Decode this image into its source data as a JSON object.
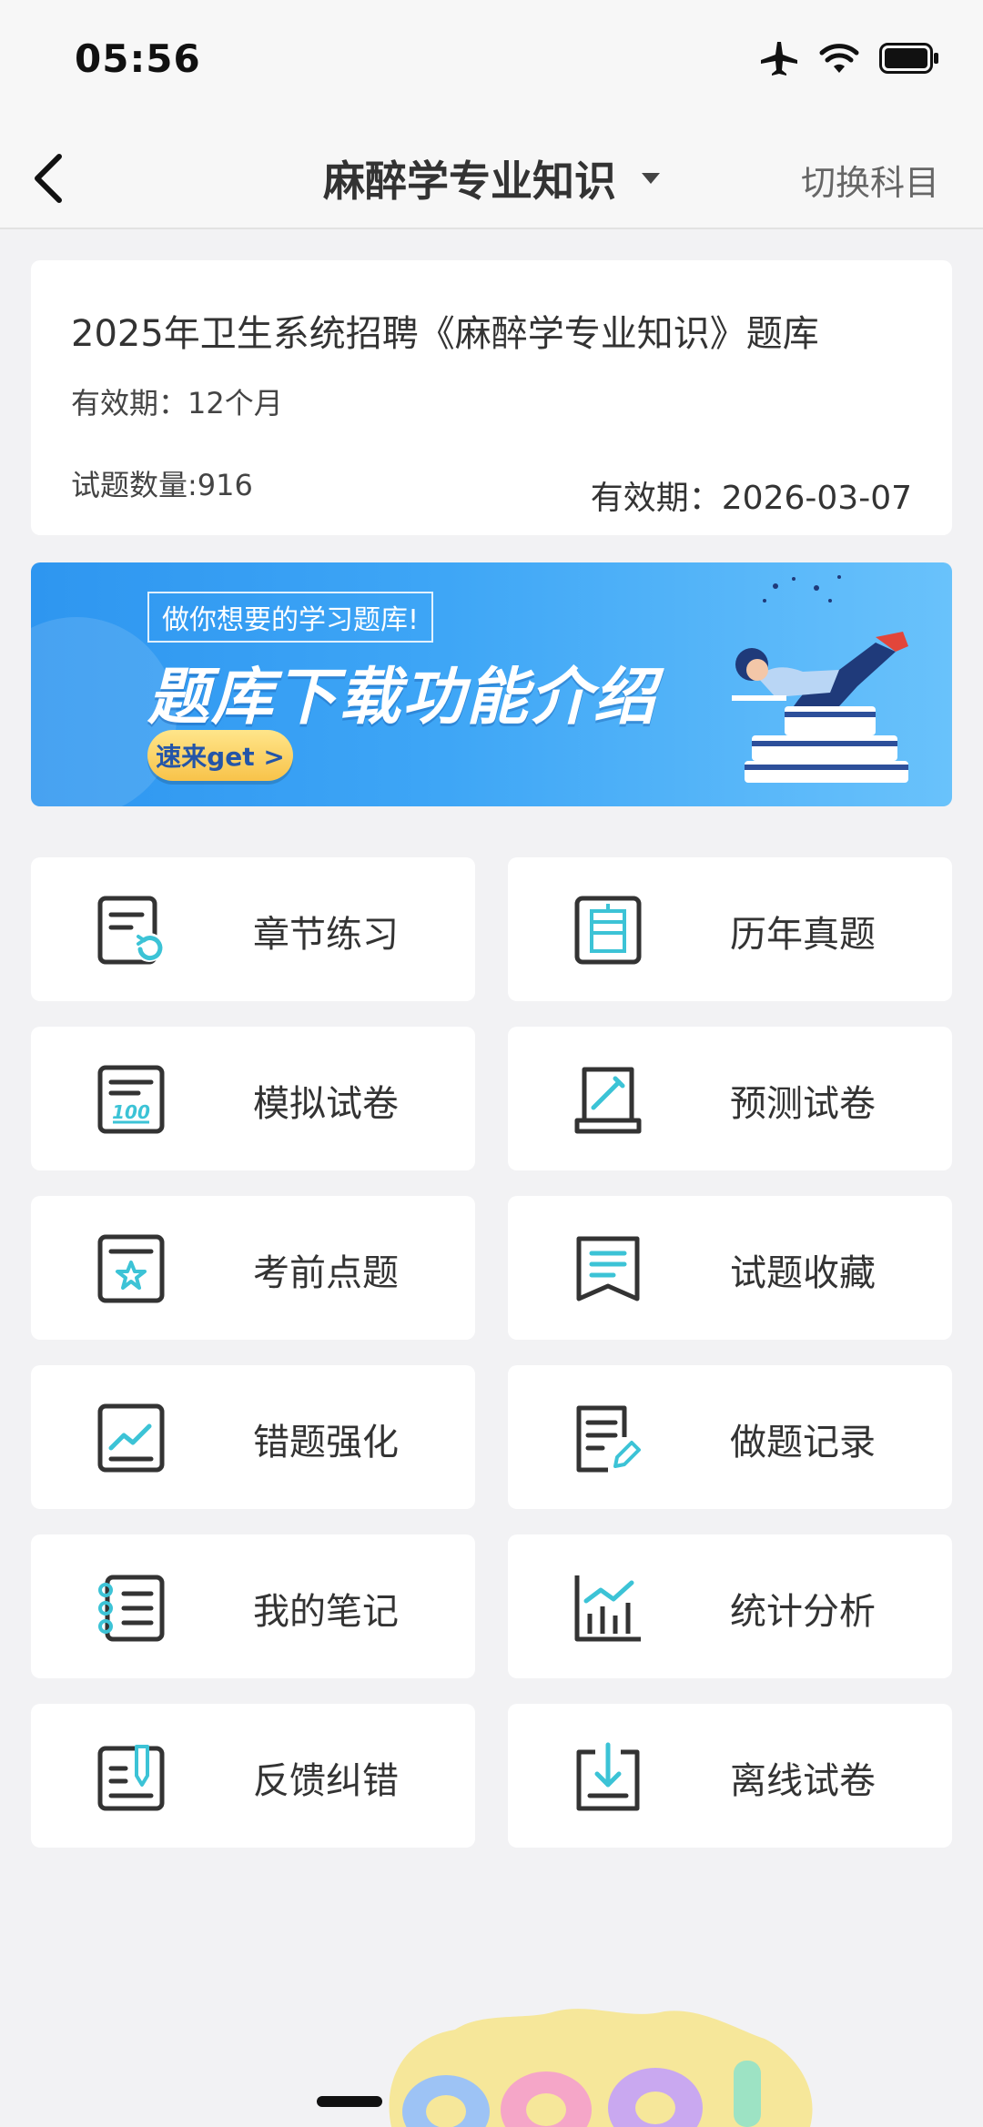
{
  "status": {
    "time": "05:56"
  },
  "nav": {
    "title": "麻醉学专业知识",
    "switch_label": "切换科目"
  },
  "info": {
    "title": "2025年卫生系统招聘《麻醉学专业知识》题库",
    "valid_period": "有效期：12个月",
    "question_count": "试题数量:916",
    "expire_date": "有效期：2026-03-07"
  },
  "banner": {
    "subtitle": "做你想要的学习题库!",
    "title": "题库下载功能介绍",
    "button": "速来get >"
  },
  "menu": [
    {
      "label": "章节练习",
      "icon": "chapter-practice-icon"
    },
    {
      "label": "历年真题",
      "icon": "past-exams-icon"
    },
    {
      "label": "模拟试卷",
      "icon": "mock-paper-icon"
    },
    {
      "label": "预测试卷",
      "icon": "forecast-paper-icon"
    },
    {
      "label": "考前点题",
      "icon": "pre-exam-tips-icon"
    },
    {
      "label": "试题收藏",
      "icon": "bookmark-icon"
    },
    {
      "label": "错题强化",
      "icon": "wrong-questions-icon"
    },
    {
      "label": "做题记录",
      "icon": "history-record-icon"
    },
    {
      "label": "我的笔记",
      "icon": "notebook-icon"
    },
    {
      "label": "统计分析",
      "icon": "statistics-icon"
    },
    {
      "label": "反馈纠错",
      "icon": "feedback-icon"
    },
    {
      "label": "离线试卷",
      "icon": "offline-download-icon"
    }
  ],
  "colors": {
    "accent": "#3cc3d6",
    "icon_stroke": "#333333",
    "banner_blue": "#2e96f0"
  }
}
